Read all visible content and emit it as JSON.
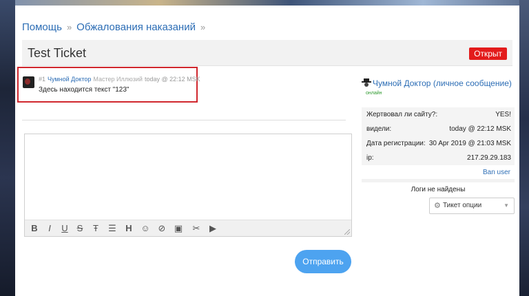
{
  "breadcrumb": {
    "items": [
      "Помощь",
      "Обжалования наказаний"
    ],
    "separator": "»"
  },
  "ticket": {
    "title": "Test Ticket",
    "status": "Открыт"
  },
  "post": {
    "number": "#1",
    "author": "Чумной Доктор",
    "role": "Мастер Иллюзий",
    "time": "today @ 22:12 MSK",
    "text": "Здесь находится текст \"123\""
  },
  "editor": {
    "toolbar": [
      "bold-icon",
      "italic-icon",
      "underline-icon",
      "strikethrough-icon",
      "text-icon",
      "list-icon",
      "heading-icon",
      "emoji-icon",
      "link-icon",
      "image-icon",
      "clear-format-icon",
      "video-icon"
    ]
  },
  "send_label": "Отправить",
  "sidebar": {
    "user_name": "Чумной Доктор",
    "pm_label": "(личное сообщение)",
    "online_label": "онлайн",
    "rows": [
      {
        "key": "Жертвовал ли сайту?:",
        "value": "YES!"
      },
      {
        "key": "видели:",
        "value": "today @ 22:12 MSK"
      },
      {
        "key": "Дата регистрации:",
        "value": "30 Apr 2019 @ 21:03 MSK"
      },
      {
        "key": "ip:",
        "value": "217.29.29.183"
      }
    ],
    "ban_label": "Ban user",
    "logs_label": "Логи не найдены",
    "options_label": "Тикет опции"
  },
  "colors": {
    "accent": "#2c6db5",
    "status": "#e31b1b",
    "send": "#4da3f0",
    "highlight": "#d0262d"
  }
}
